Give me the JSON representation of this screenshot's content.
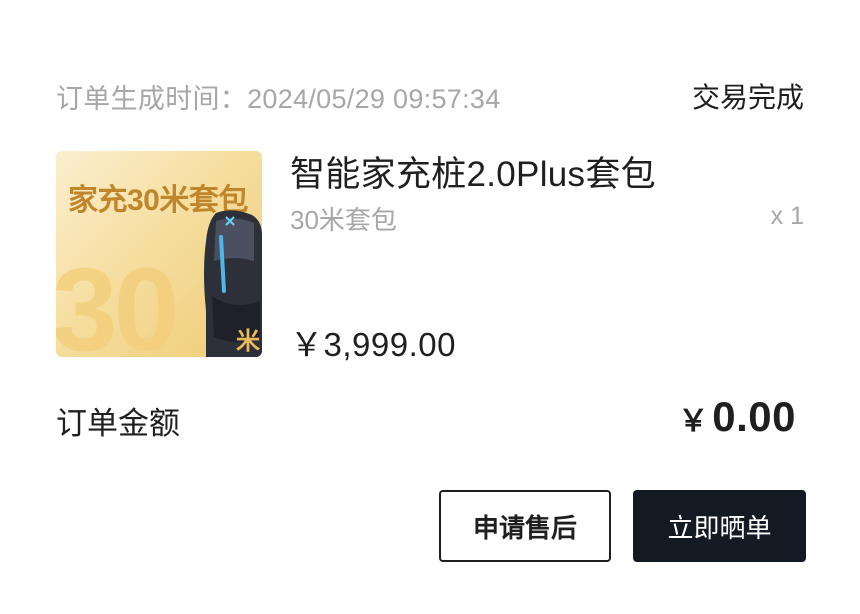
{
  "order": {
    "time_label": "订单生成时间：",
    "time_value": "2024/05/29 09:57:34",
    "status": "交易完成"
  },
  "product": {
    "thumbnail": {
      "title": "家充30米套包",
      "big_number": "30",
      "unit": "米",
      "device_icon": "charger-icon"
    },
    "name": "智能家充桩2.0Plus套包",
    "spec": "30米套包",
    "quantity": "x 1",
    "price": "￥3,999.00"
  },
  "amount": {
    "label": "订单金额",
    "currency": "￥",
    "value": "0.00"
  },
  "actions": {
    "after_sale": "申请售后",
    "share_order": "立即晒单"
  },
  "colors": {
    "primary_button_bg": "#131a23",
    "muted_text": "#a7a7a7",
    "thumbnail_gold": "#c0862b"
  }
}
